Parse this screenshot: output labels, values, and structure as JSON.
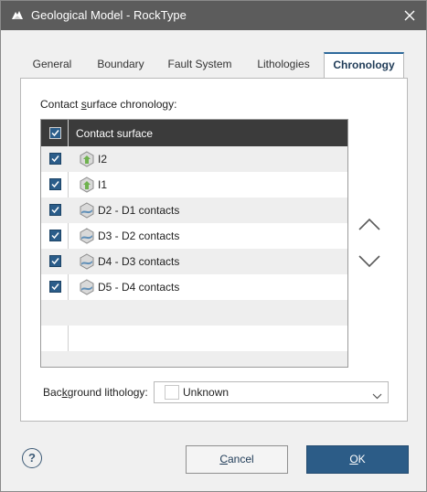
{
  "window": {
    "title": "Geological Model - RockType",
    "app_icon": "leapfrog-logo-icon",
    "close_icon": "close-icon"
  },
  "tabs": [
    {
      "label": "General",
      "active": false
    },
    {
      "label": "Boundary",
      "active": false
    },
    {
      "label": "Fault System",
      "active": false
    },
    {
      "label": "Lithologies",
      "active": false
    },
    {
      "label": "Chronology",
      "active": true
    }
  ],
  "chronology": {
    "section_label_pre": "Contact ",
    "section_label_mnemonic": "s",
    "section_label_post": "urface chronology:",
    "column_header": "Contact surface",
    "header_checked": true,
    "rows": [
      {
        "label": "I2",
        "checked": true,
        "icon": "intrusion-surface-icon"
      },
      {
        "label": "I1",
        "checked": true,
        "icon": "intrusion-surface-icon"
      },
      {
        "label": "D2 - D1 contacts",
        "checked": true,
        "icon": "deposit-contact-icon"
      },
      {
        "label": "D3 - D2 contacts",
        "checked": true,
        "icon": "deposit-contact-icon"
      },
      {
        "label": "D4 - D3 contacts",
        "checked": true,
        "icon": "deposit-contact-icon"
      },
      {
        "label": "D5 - D4 contacts",
        "checked": true,
        "icon": "deposit-contact-icon"
      }
    ],
    "move_up_icon": "chevron-up-icon",
    "move_down_icon": "chevron-down-icon"
  },
  "background_lithology": {
    "label_pre": "Bac",
    "label_mnemonic": "k",
    "label_post": "ground lithology:",
    "value": "Unknown",
    "swatch_color": "#ffffff"
  },
  "footer": {
    "help_label": "?",
    "cancel_mnemonic": "C",
    "cancel_rest": "ancel",
    "ok_mnemonic": "O",
    "ok_rest": "K"
  },
  "colors": {
    "titlebar": "#5c5c5c",
    "accent": "#2c5c87",
    "grid_header": "#3b3b3b",
    "checkbox": "#2b5d8a"
  }
}
